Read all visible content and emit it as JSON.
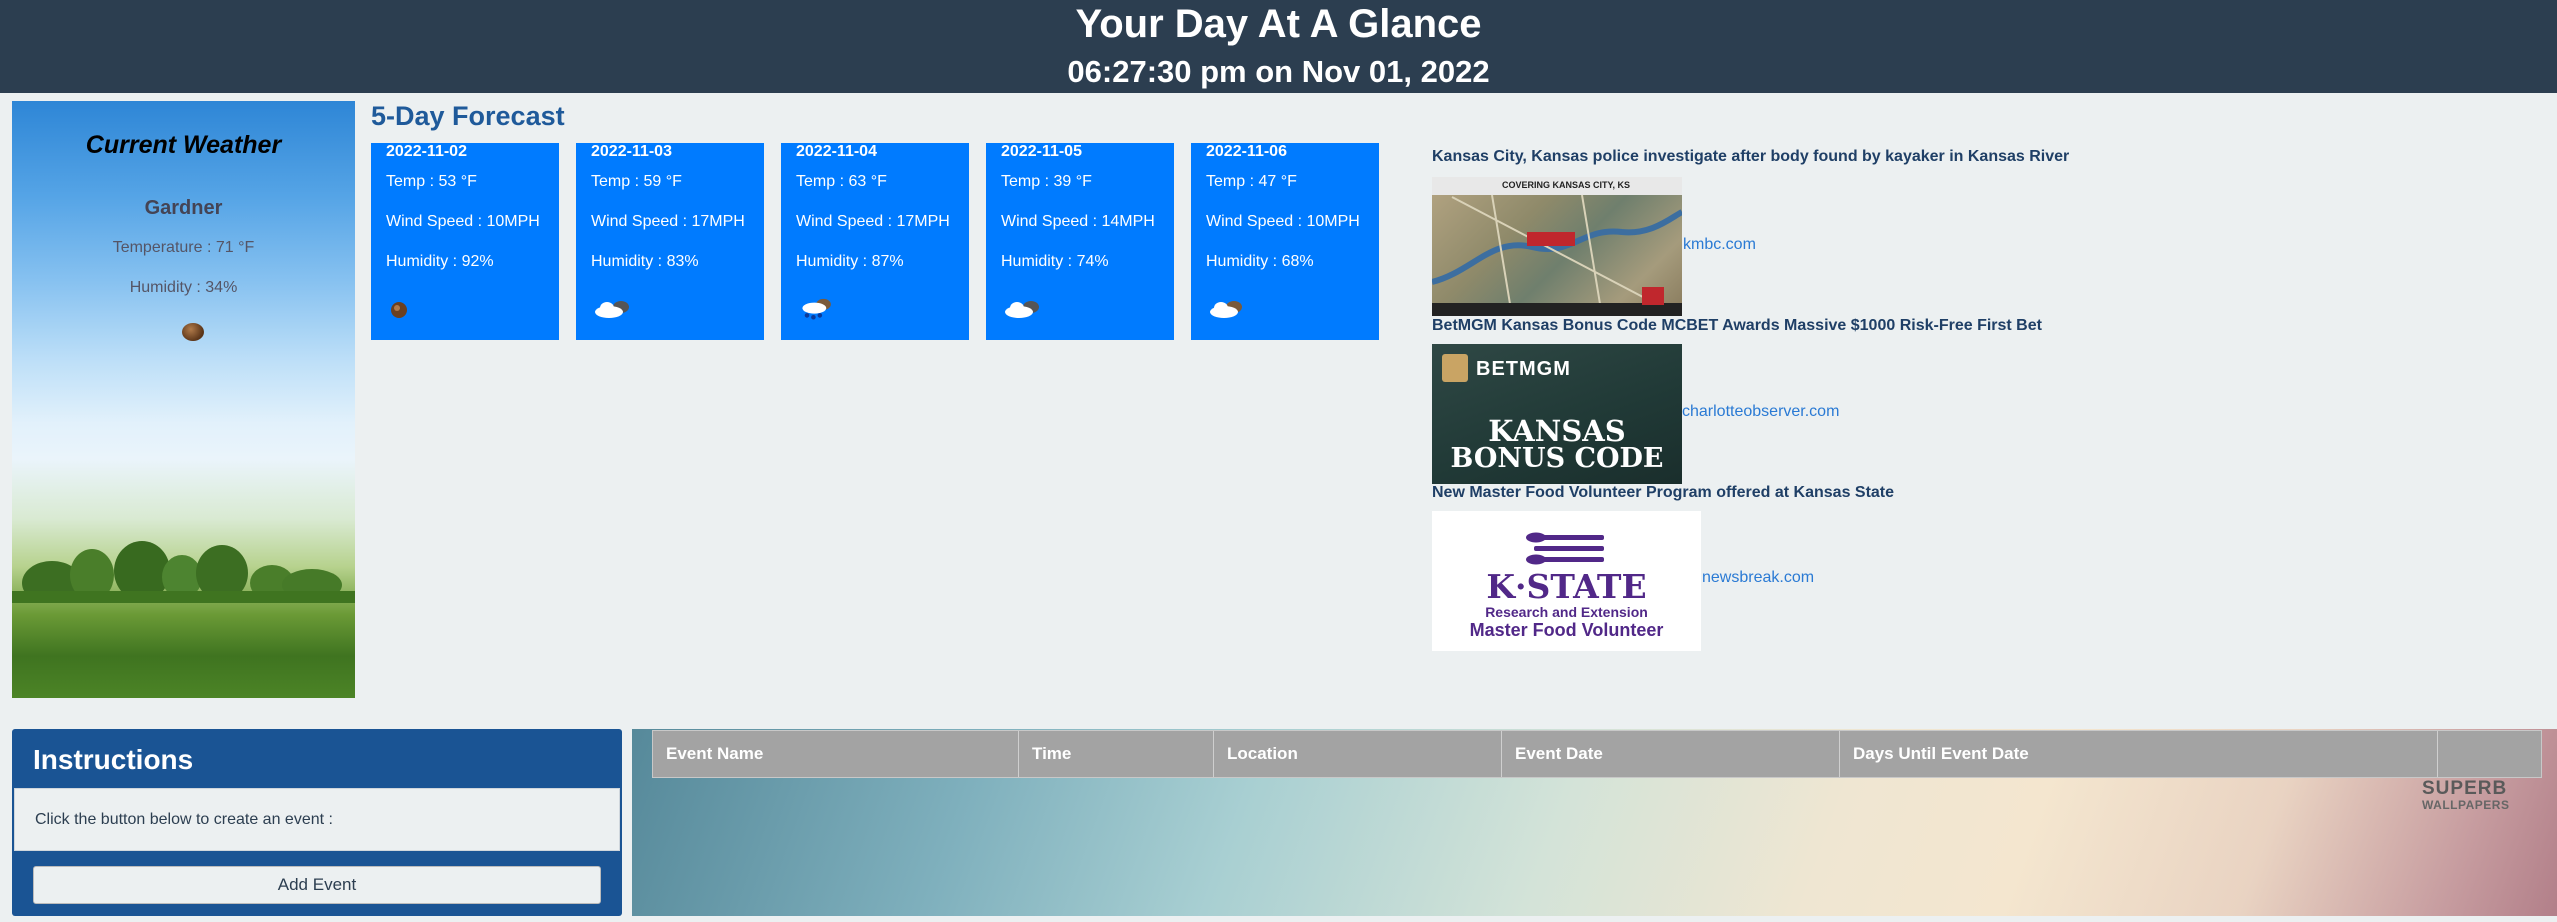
{
  "header": {
    "title": "Your Day At A Glance",
    "datetime": "06:27:30 pm on Nov 01, 2022"
  },
  "current_weather": {
    "title": "Current Weather",
    "city": "Gardner",
    "temperature": "Temperature : 71 °F",
    "humidity": "Humidity : 34%",
    "icon": "sunny-brown-ball-icon"
  },
  "forecast": {
    "heading": "5-Day Forecast",
    "days": [
      {
        "date": "2022-11-02",
        "temp": "Temp : 53 °F",
        "wind": "Wind Speed : 10MPH",
        "humidity": "Humidity : 92%",
        "icon": "sun-icon"
      },
      {
        "date": "2022-11-03",
        "temp": "Temp : 59 °F",
        "wind": "Wind Speed : 17MPH",
        "humidity": "Humidity : 83%",
        "icon": "cloudy-icon"
      },
      {
        "date": "2022-11-04",
        "temp": "Temp : 63 °F",
        "wind": "Wind Speed : 17MPH",
        "humidity": "Humidity : 87%",
        "icon": "rain-icon"
      },
      {
        "date": "2022-11-05",
        "temp": "Temp : 39 °F",
        "wind": "Wind Speed : 14MPH",
        "humidity": "Humidity : 74%",
        "icon": "cloudy-icon"
      },
      {
        "date": "2022-11-06",
        "temp": "Temp : 47 °F",
        "wind": "Wind Speed : 10MPH",
        "humidity": "Humidity : 68%",
        "icon": "partly-cloudy-icon"
      }
    ]
  },
  "news": [
    {
      "title": "Kansas City, Kansas police investigate after body found by kayaker in Kansas River",
      "source": "kmbc.com",
      "image": "river-map-image",
      "image_text": "COVERING KANSAS CITY, KS"
    },
    {
      "title": "BetMGM Kansas Bonus Code MCBET Awards Massive $1000 Risk-Free First Bet",
      "source": "charlotteobserver.com",
      "image": "betmgm-image",
      "image_brand": "BETMGM",
      "image_line1": "KANSAS",
      "image_line2": "BONUS CODE"
    },
    {
      "title": "New Master Food Volunteer Program offered at Kansas State",
      "source": "newsbreak.com",
      "image": "kstate-image",
      "image_line1": "K·STATE",
      "image_line2": "Research and Extension",
      "image_line3": "Master Food Volunteer"
    }
  ],
  "instructions": {
    "title": "Instructions",
    "body": "Click the button below to create an event :",
    "button_label": "Add Event"
  },
  "events_table": {
    "columns": [
      "Event Name",
      "Time",
      "Location",
      "Event Date",
      "Days Until Event Date"
    ]
  },
  "watermark": {
    "line1": "SUPERB",
    "line2": "WALLPAPERS"
  },
  "colors": {
    "header": "#2c3e50",
    "card": "#007bff",
    "instructions": "#1a5494",
    "link": "#2a7ad4"
  }
}
